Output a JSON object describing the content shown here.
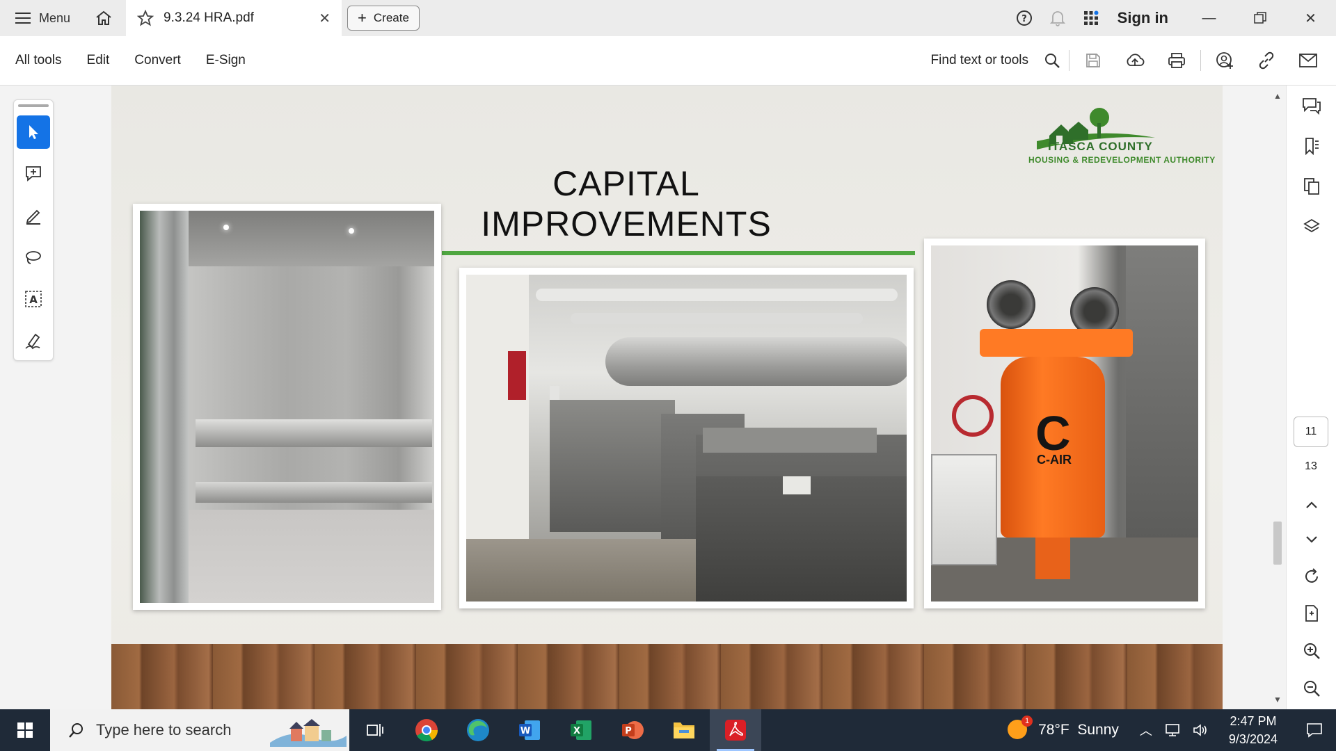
{
  "titlebar": {
    "menu_label": "Menu",
    "tab_title": "9.3.24 HRA.pdf",
    "create_label": "Create",
    "sign_in_label": "Sign in"
  },
  "toolbar": {
    "menu_items": [
      "All tools",
      "Edit",
      "Convert",
      "E-Sign"
    ],
    "find_label": "Find text or tools"
  },
  "slide": {
    "title": "CAPITAL IMPROVEMENTS",
    "logo_line1": "ITASCA COUNTY",
    "logo_line2": "HOUSING & REDEVELOPMENT AUTHORITY",
    "compressor_brand": "C-AIR"
  },
  "right_rail": {
    "current_page": "11",
    "total_pages": "13"
  },
  "taskbar": {
    "search_placeholder": "Type here to search",
    "weather": "78°F  Sunny",
    "weather_badge": "1",
    "time": "2:47 PM",
    "date": "9/3/2024"
  },
  "colors": {
    "accent": "#1473e6",
    "green_line": "#4fa640",
    "taskbar": "#1f2a38"
  }
}
